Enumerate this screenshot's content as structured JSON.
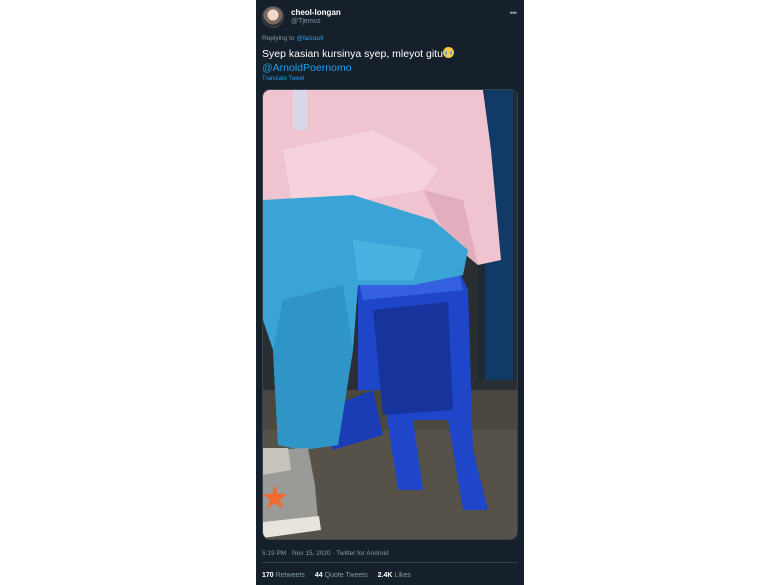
{
  "tweet": {
    "display_name": "cheol-longan",
    "handle": "@Tjemvz",
    "more_icon": "more-horizontal-icon",
    "replying_prefix": "Replying to",
    "replying_to": "@faizaufi",
    "text": "Syep kasian kursinya syep, mleyot gitu",
    "emoji": "crying-face-emoji",
    "mention": "@ArnoldPoernomo",
    "translate": "Translate Tweet",
    "timestamp": "5:19 PM · Nov 15, 2020 · Twitter for Android",
    "stats": {
      "retweets_count": "170",
      "retweets_label": "Retweets",
      "quotes_count": "44",
      "quotes_label": "Quote Tweets",
      "likes_count": "2.4K",
      "likes_label": "Likes"
    }
  },
  "colors": {
    "background": "#15202b",
    "link": "#1da1f2",
    "muted": "#8899a6",
    "stool": "#1f45c9",
    "pants": "#3aa4d6",
    "jacket": "#f0c6d3"
  }
}
